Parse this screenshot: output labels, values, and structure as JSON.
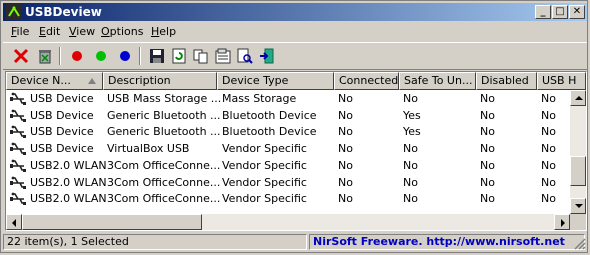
{
  "window": {
    "title": "USBDeview"
  },
  "menu": [
    {
      "label": "File",
      "ul": "F",
      "rest": "ile"
    },
    {
      "label": "Edit",
      "ul": "E",
      "rest": "dit"
    },
    {
      "label": "View",
      "ul": "V",
      "rest": "iew"
    },
    {
      "label": "Options",
      "ul": "O",
      "rest": "ptions"
    },
    {
      "label": "Help",
      "ul": "H",
      "rest": "elp"
    }
  ],
  "toolbar": {
    "buttons": [
      "disconnect-icon",
      "uninstall-icon",
      "red-dot-icon",
      "green-dot-icon",
      "blue-dot-icon",
      "save-icon",
      "refresh-icon",
      "copy-icon",
      "properties-icon",
      "find-icon",
      "exit-icon"
    ]
  },
  "list": {
    "columns": [
      "Device N...",
      "Description",
      "Device Type",
      "Connected",
      "Safe To Un...",
      "Disabled",
      "USB H"
    ],
    "rows": [
      [
        "USB Device",
        "USB Mass Storage ...",
        "Mass Storage",
        "No",
        "No",
        "No",
        "No"
      ],
      [
        "USB Device",
        "Generic Bluetooth ...",
        "Bluetooth Device",
        "No",
        "Yes",
        "No",
        "No"
      ],
      [
        "USB Device",
        "Generic Bluetooth ...",
        "Bluetooth Device",
        "No",
        "Yes",
        "No",
        "No"
      ],
      [
        "USB Device",
        "VirtualBox USB",
        "Vendor Specific",
        "No",
        "No",
        "No",
        "No"
      ],
      [
        "USB2.0 WLAN",
        "3Com OfficeConne...",
        "Vendor Specific",
        "No",
        "No",
        "No",
        "No"
      ],
      [
        "USB2.0 WLAN",
        "3Com OfficeConne...",
        "Vendor Specific",
        "No",
        "No",
        "No",
        "No"
      ],
      [
        "USB2.0 WLAN",
        "3Com OfficeConne...",
        "Vendor Specific",
        "No",
        "No",
        "No",
        "No"
      ]
    ]
  },
  "status": {
    "items": "22 item(s), 1 Selected",
    "link": "NirSoft Freeware.  http://www.nirsoft.net"
  },
  "colors": {
    "titlebar_start": "#0a246a",
    "titlebar_end": "#a6caf0",
    "link": "#0000c0"
  }
}
